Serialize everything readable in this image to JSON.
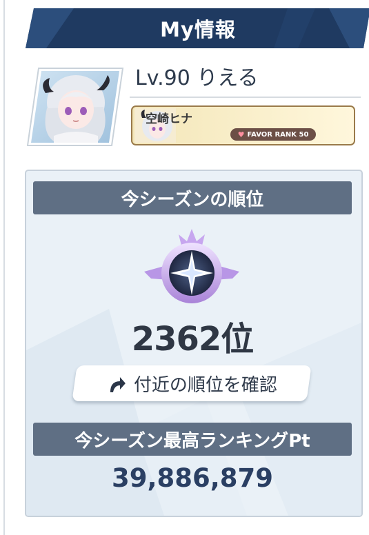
{
  "header": {
    "title": "My情報"
  },
  "profile": {
    "player_name": "Lv.90 りえる",
    "student": {
      "name": "空崎ヒナ",
      "favor_label": "FAVOR RANK 50"
    }
  },
  "season": {
    "rank_heading": "今シーズンの順位",
    "rank_value": "2362位",
    "nearby_button_label": "付近の順位を確認",
    "best_heading": "今シーズン最高ランキングPt",
    "best_value": "39,886,879"
  },
  "icons": {
    "avatar": "character-portrait",
    "rank": "rank-emblem-icon",
    "nearby": "curved-arrow-icon",
    "favor": "heart-icon"
  },
  "colors": {
    "header_bg": "#1f3a61",
    "section_bar": "#5f6f84",
    "best_value": "#2a3f63",
    "rank_value": "#2f3744"
  }
}
